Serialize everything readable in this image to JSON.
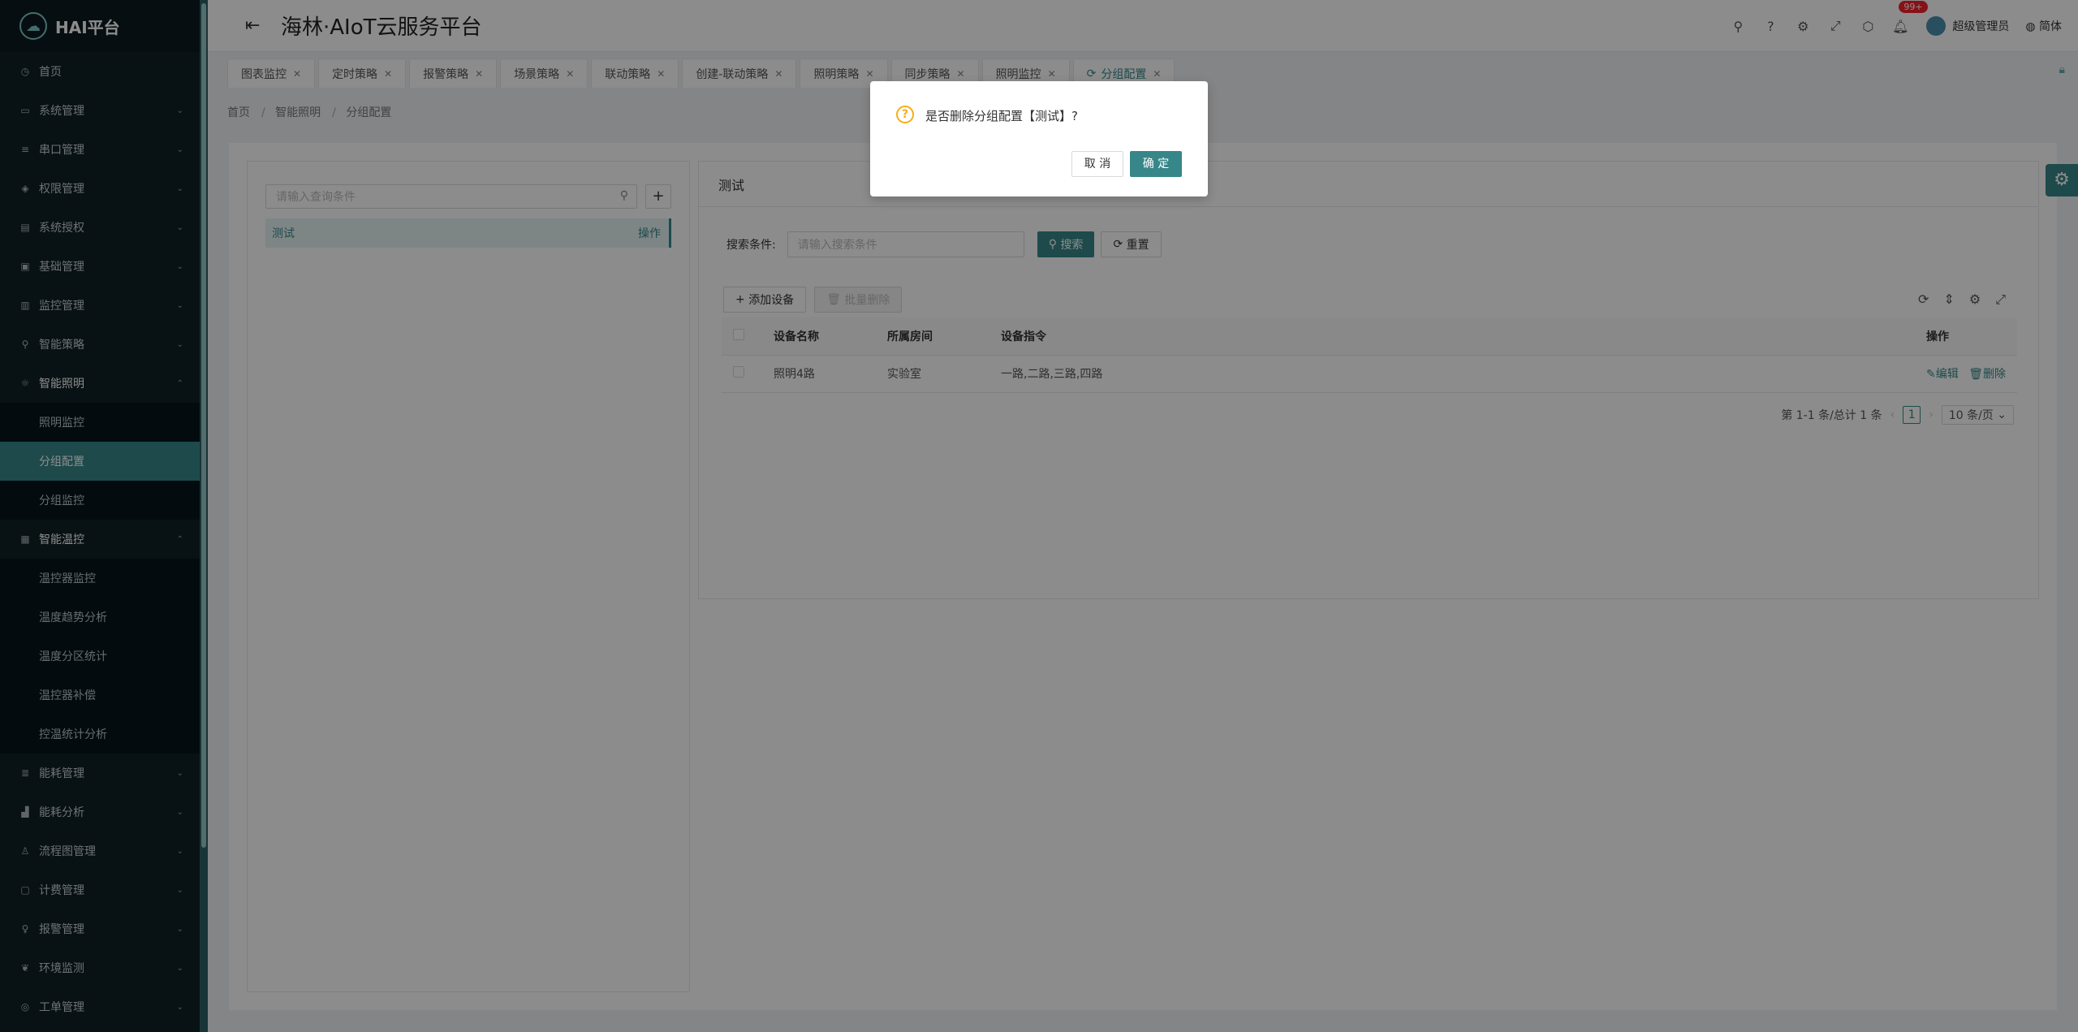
{
  "app": {
    "logo_text": "HAI平台",
    "platform_title": "海林·AIoT云服务平台"
  },
  "sidebar": {
    "items": [
      {
        "label": "首页",
        "icon": "dashboard-icon"
      },
      {
        "label": "系统管理",
        "icon": "system-icon"
      },
      {
        "label": "串口管理",
        "icon": "serial-icon"
      },
      {
        "label": "权限管理",
        "icon": "shield-icon"
      },
      {
        "label": "系统授权",
        "icon": "license-icon"
      },
      {
        "label": "基础管理",
        "icon": "base-icon"
      },
      {
        "label": "监控管理",
        "icon": "monitor-icon"
      },
      {
        "label": "智能策略",
        "icon": "strategy-icon"
      },
      {
        "label": "智能照明",
        "icon": "bulb-icon"
      },
      {
        "label": "照明监控"
      },
      {
        "label": "分组配置"
      },
      {
        "label": "分组监控"
      },
      {
        "label": "智能温控",
        "icon": "thermo-icon"
      },
      {
        "label": "温控器监控"
      },
      {
        "label": "温度趋势分析"
      },
      {
        "label": "温度分区统计"
      },
      {
        "label": "温控器补偿"
      },
      {
        "label": "控温统计分析"
      },
      {
        "label": "能耗管理",
        "icon": "energy-icon"
      },
      {
        "label": "能耗分析",
        "icon": "chart-icon"
      },
      {
        "label": "流程图管理",
        "icon": "flow-icon"
      },
      {
        "label": "计费管理",
        "icon": "billing-icon"
      },
      {
        "label": "报警管理",
        "icon": "alarm-icon"
      },
      {
        "label": "环境监测",
        "icon": "env-icon"
      },
      {
        "label": "工单管理",
        "icon": "ticket-icon"
      }
    ]
  },
  "header": {
    "badge": "99+",
    "user": "超级管理员",
    "lang": "简体"
  },
  "tabs": [
    {
      "label": "图表监控"
    },
    {
      "label": "定时策略"
    },
    {
      "label": "报警策略"
    },
    {
      "label": "场景策略"
    },
    {
      "label": "联动策略"
    },
    {
      "label": "创建-联动策略"
    },
    {
      "label": "照明策略"
    },
    {
      "label": "同步策略"
    },
    {
      "label": "照明监控"
    },
    {
      "label": "分组配置"
    }
  ],
  "breadcrumb": [
    "首页",
    "智能照明",
    "分组配置"
  ],
  "left_panel": {
    "search_placeholder": "请输入查询条件",
    "group_name": "测试",
    "group_op": "操作"
  },
  "right_panel": {
    "title": "测试",
    "filter_label": "搜索条件:",
    "filter_placeholder": "请输入搜索条件",
    "search_btn": "搜索",
    "reset_btn": "重置",
    "add_btn": "添加设备",
    "batch_delete_btn": "批量删除",
    "columns": [
      "设备名称",
      "所属房间",
      "设备指令",
      "操作"
    ],
    "rows": [
      {
        "name": "照明4路",
        "room": "实验室",
        "cmd": "一路,二路,三路,四路",
        "edit": "编辑",
        "delete": "删除"
      }
    ],
    "pagination": {
      "summary": "第 1-1 条/总计 1 条",
      "page": "1",
      "page_size": "10 条/页"
    }
  },
  "modal": {
    "message": "是否删除分组配置【测试】?",
    "cancel": "取 消",
    "ok": "确 定"
  },
  "colors": {
    "primary": "#37878a",
    "sidebar_bg": "#0f1f26",
    "warning": "#faad14",
    "badge": "#f5222d"
  }
}
